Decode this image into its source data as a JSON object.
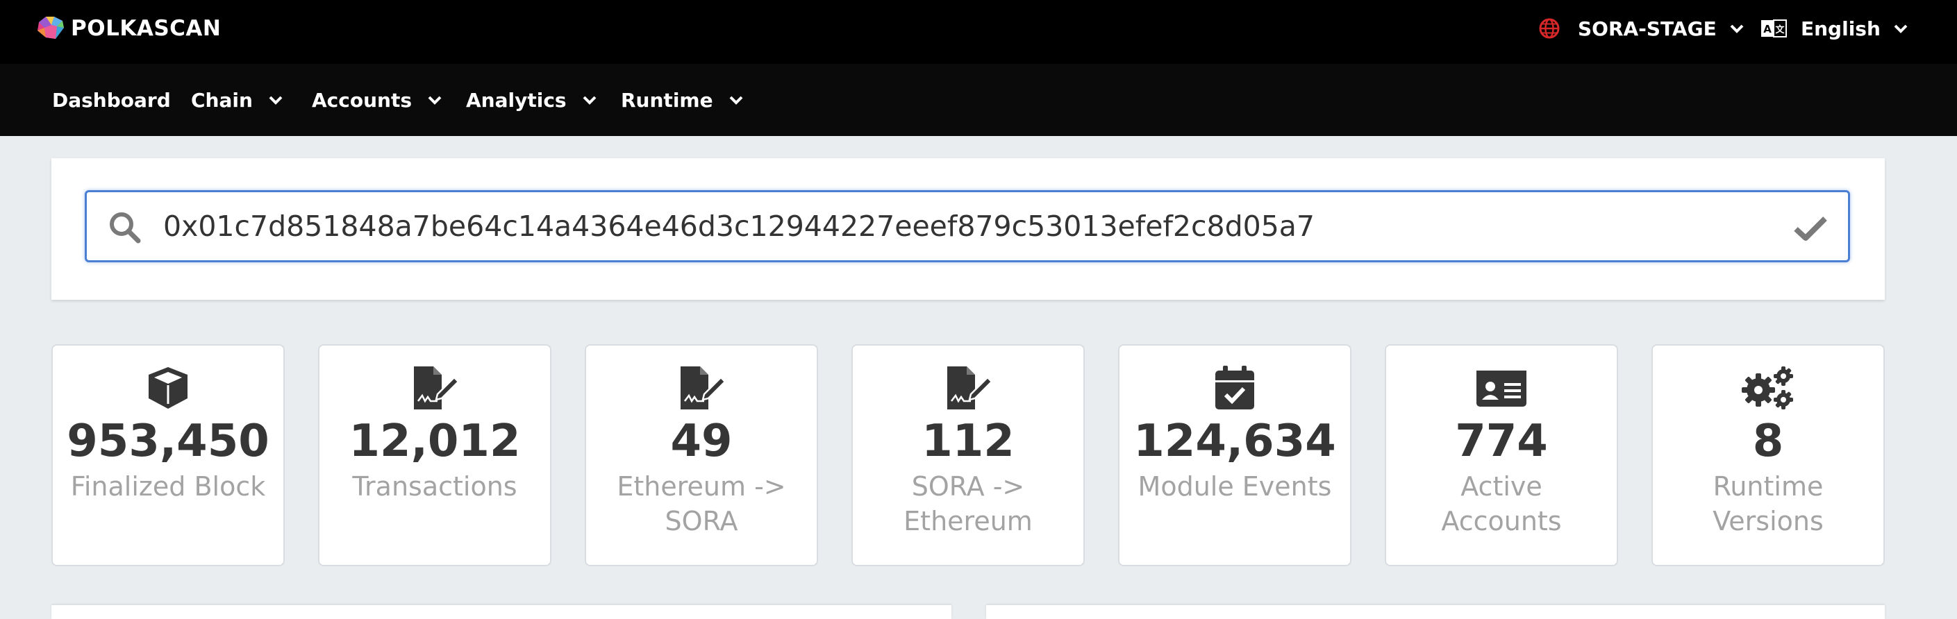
{
  "brand": {
    "name": "POLKASCAN"
  },
  "header": {
    "network": "SORA-STAGE",
    "language": "English"
  },
  "nav": {
    "items": [
      {
        "label": "Dashboard"
      },
      {
        "label": "Chain"
      },
      {
        "label": "Accounts"
      },
      {
        "label": "Analytics"
      },
      {
        "label": "Runtime"
      }
    ]
  },
  "search": {
    "value": "0x01c7d851848a7be64c14a4364e46d3c12944227eeef879c53013efef2c8d05a7"
  },
  "stats": [
    {
      "icon": "cube-icon",
      "value": "953,450",
      "label": "Finalized Block"
    },
    {
      "icon": "file-signature-icon",
      "value": "12,012",
      "label": "Transactions"
    },
    {
      "icon": "file-signature-icon",
      "value": "49",
      "label": "Ethereum -> SORA"
    },
    {
      "icon": "file-signature-icon",
      "value": "112",
      "label": "SORA -> Ethereum"
    },
    {
      "icon": "calendar-check-icon",
      "value": "124,634",
      "label": "Module Events"
    },
    {
      "icon": "id-card-icon",
      "value": "774",
      "label": "Active Accounts"
    },
    {
      "icon": "cogs-icon",
      "value": "8",
      "label": "Runtime Versions"
    }
  ],
  "colors": {
    "topbar": "#000000",
    "navbar": "#0a0a0a",
    "page_bg": "#eaedf0",
    "focus_border": "#4a7fd4",
    "globe": "#d62828",
    "stat_value": "#363636",
    "stat_label": "#a3a3a3"
  }
}
